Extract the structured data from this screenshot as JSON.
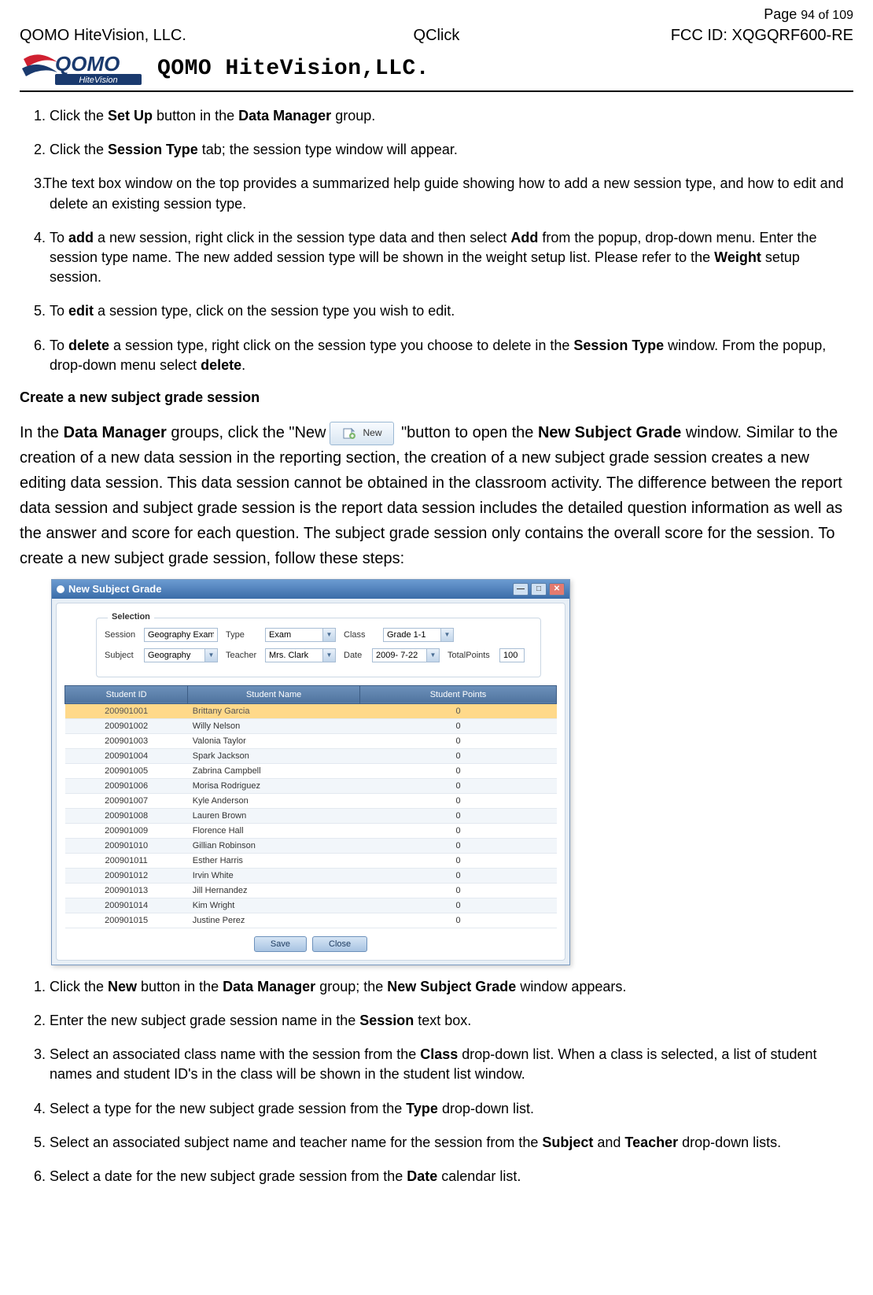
{
  "page": {
    "label": "Page ",
    "num": "94 of 109"
  },
  "header": {
    "company": "QOMO HiteVision, LLC.",
    "app": "QClick",
    "fcc": "FCC ID: XQGQRF600-RE",
    "title": "QOMO HiteVision,LLC."
  },
  "list1": {
    "i1_a": "Click the ",
    "i1_b": "Set Up",
    "i1_c": " button in the ",
    "i1_d": "Data Manager",
    "i1_e": " group.",
    "i2_a": "Click the ",
    "i2_b": "Session Type",
    "i2_c": " tab; the session type window will appear.",
    "i3_a": "The text box window on the top provides a summarized help guide showing how to add a new session type, and how to edit and delete an existing session type.",
    "i4_a": "To ",
    "i4_b": "add",
    "i4_c": " a new session, right click in the session type data and then select ",
    "i4_d": "Add",
    "i4_e": " from the popup, drop-down menu. Enter the session type name. The new added session type will be shown in the weight setup list. Please refer to the ",
    "i4_f": "Weight",
    "i4_g": " setup session.",
    "i5_a": "To ",
    "i5_b": "edit",
    "i5_c": " a session type, click on the session type you wish to edit.",
    "i6_a": "To ",
    "i6_b": "delete",
    "i6_c": " a session type, right click on the session type you choose to delete in the ",
    "i6_d": "Session Type",
    "i6_e": " window. From the popup, drop-down menu select ",
    "i6_f": "delete",
    "i6_g": "."
  },
  "subheading": "Create a new subject grade session",
  "para": {
    "p1a": "In the ",
    "p1b": "Data Manager",
    "p1c": " groups, click the \"New",
    "new_btn_label": "New",
    "p1d": " \"button to open the ",
    "p1e": "New Subject Grade",
    "p1f": " window. Similar to the creation of a new data session in the reporting section, the creation of a new subject grade session creates a new editing data session. This data session cannot be obtained in the classroom activity. The difference between the report data session and subject grade session is the report data session includes the detailed question information as well as the answer and score for each question. The subject grade session only contains the overall score for the session. To create a new subject grade session, follow these steps:"
  },
  "dialog": {
    "title": "New Subject Grade",
    "section_label": "Selection",
    "labels": {
      "session": "Session",
      "type": "Type",
      "class": "Class",
      "subject": "Subject",
      "teacher": "Teacher",
      "date": "Date",
      "totalpoints": "TotalPoints"
    },
    "values": {
      "session": "Geography Exam",
      "type": "Exam",
      "class": "Grade 1-1",
      "subject": "Geography",
      "teacher": "Mrs. Clark",
      "date": "2009- 7-22",
      "totalpoints": "100"
    },
    "columns": {
      "id": "Student ID",
      "name": "Student Name",
      "points": "Student Points"
    },
    "students": [
      {
        "id": "200901001",
        "name": "Brittany Garcia",
        "points": "0",
        "selected": true
      },
      {
        "id": "200901002",
        "name": "Willy Nelson",
        "points": "0"
      },
      {
        "id": "200901003",
        "name": "Valonia Taylor",
        "points": "0"
      },
      {
        "id": "200901004",
        "name": "Spark Jackson",
        "points": "0"
      },
      {
        "id": "200901005",
        "name": "Zabrina Campbell",
        "points": "0"
      },
      {
        "id": "200901006",
        "name": "Morisa Rodriguez",
        "points": "0"
      },
      {
        "id": "200901007",
        "name": "Kyle Anderson",
        "points": "0"
      },
      {
        "id": "200901008",
        "name": "Lauren Brown",
        "points": "0"
      },
      {
        "id": "200901009",
        "name": "Florence Hall",
        "points": "0"
      },
      {
        "id": "200901010",
        "name": "Gillian Robinson",
        "points": "0"
      },
      {
        "id": "200901011",
        "name": "Esther Harris",
        "points": "0"
      },
      {
        "id": "200901012",
        "name": "Irvin White",
        "points": "0"
      },
      {
        "id": "200901013",
        "name": "Jill Hernandez",
        "points": "0"
      },
      {
        "id": "200901014",
        "name": "Kim Wright",
        "points": "0"
      },
      {
        "id": "200901015",
        "name": "Justine Perez",
        "points": "0"
      }
    ],
    "buttons": {
      "save": "Save",
      "close": "Close"
    }
  },
  "list2": {
    "i1_a": "Click the ",
    "i1_b": "New",
    "i1_c": " button in the ",
    "i1_d": "Data Manager",
    "i1_e": " group; the ",
    "i1_f": "New Subject Grade",
    "i1_g": " window appears.",
    "i2_a": "Enter the new subject grade session name in the ",
    "i2_b": "Session",
    "i2_c": " text box.",
    "i3_a": "Select an associated class name with the session from the ",
    "i3_b": "Class",
    "i3_c": " drop-down list. When a class is selected, a list of student names and student ID's in the class will be shown in the student list window.",
    "i4_a": "Select a type for the new subject grade session from the ",
    "i4_b": "Type",
    "i4_c": " drop-down list.",
    "i5_a": "Select an associated subject name and teacher name for the session from the ",
    "i5_b": "Subject",
    "i5_c": " and ",
    "i5_d": "Teacher",
    "i5_e": " drop-down lists.",
    "i6_a": "Select a date for the new subject grade session from the ",
    "i6_b": "Date",
    "i6_c": " calendar list."
  }
}
